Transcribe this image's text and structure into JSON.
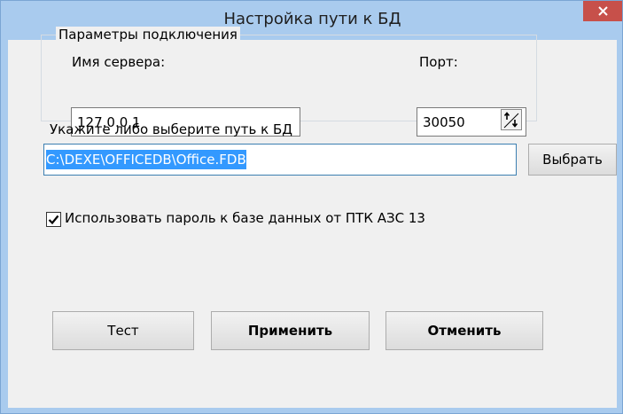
{
  "window": {
    "title": "Настройка пути к БД"
  },
  "connection_group": {
    "legend": "Параметры подключения",
    "server_label": "Имя сервера:",
    "server_value": "127.0.0.1",
    "port_label": "Порт:",
    "port_value": "30050"
  },
  "path_section": {
    "label": "Укажите либо выберите путь к БД",
    "path_value": "C:\\DEXE\\OFFICEDB\\Office.FDB",
    "browse_label": "Выбрать"
  },
  "password_option": {
    "label": "Использовать пароль к базе данных от ПТК АЗС 13",
    "checked": true
  },
  "footer": {
    "test_label": "Тест",
    "apply_label": "Применить",
    "cancel_label": "Отменить"
  },
  "colors": {
    "frame": "#a9cbee",
    "close": "#c7504a",
    "selection": "#3399ff"
  }
}
